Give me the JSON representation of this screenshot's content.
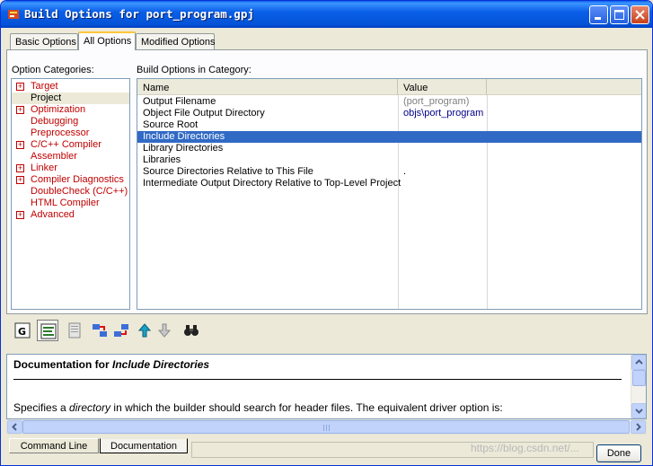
{
  "window": {
    "title": "Build Options for port_program.gpj"
  },
  "tabs": [
    "Basic Options",
    "All Options",
    "Modified Options"
  ],
  "left": {
    "label": "Option Categories:",
    "items": [
      {
        "label": "Target",
        "expander": "⊞"
      },
      {
        "label": "Project",
        "expander": ""
      },
      {
        "label": "Optimization",
        "expander": "⊞"
      },
      {
        "label": "Debugging",
        "expander": ""
      },
      {
        "label": "Preprocessor",
        "expander": ""
      },
      {
        "label": "C/C++ Compiler",
        "expander": "⊞"
      },
      {
        "label": "Assembler",
        "expander": ""
      },
      {
        "label": "Linker",
        "expander": "⊞"
      },
      {
        "label": "Compiler Diagnostics",
        "expander": "⊞"
      },
      {
        "label": "DoubleCheck (C/C++)",
        "expander": ""
      },
      {
        "label": "HTML Compiler",
        "expander": ""
      },
      {
        "label": "Advanced",
        "expander": "⊞"
      }
    ]
  },
  "right": {
    "label": "Build Options in Category:",
    "columns": [
      "Name",
      "Value"
    ],
    "rows": [
      {
        "name": "Output Filename",
        "value": "(port_program)"
      },
      {
        "name": "Object File Output Directory",
        "value": "objs\\port_program"
      },
      {
        "name": "Source Root",
        "value": ""
      },
      {
        "name": "Include Directories",
        "value": ""
      },
      {
        "name": "Library Directories",
        "value": ""
      },
      {
        "name": "Libraries",
        "value": ""
      },
      {
        "name": "Source Directories Relative to This File",
        "value": "."
      },
      {
        "name": "Intermediate Output Directory Relative to Top-Level Project",
        "value": ""
      }
    ]
  },
  "doc": {
    "title_prefix": "Documentation for ",
    "title_item": "Include Directories",
    "body_prefix": "Specifies a ",
    "body_em": "directory",
    "body_suffix": " in which the builder should search for header files. The equivalent driver option is:"
  },
  "bottom": {
    "tabs": [
      "Command Line",
      "Documentation"
    ],
    "done": "Done",
    "watermark": "https://blog.csdn.net/..."
  },
  "colors": {
    "titlebar": "#0a5fe8",
    "category_text": "#c00000",
    "selection": "#316ac5",
    "value_default": "#7f7f7f",
    "value_set": "#00008b"
  }
}
